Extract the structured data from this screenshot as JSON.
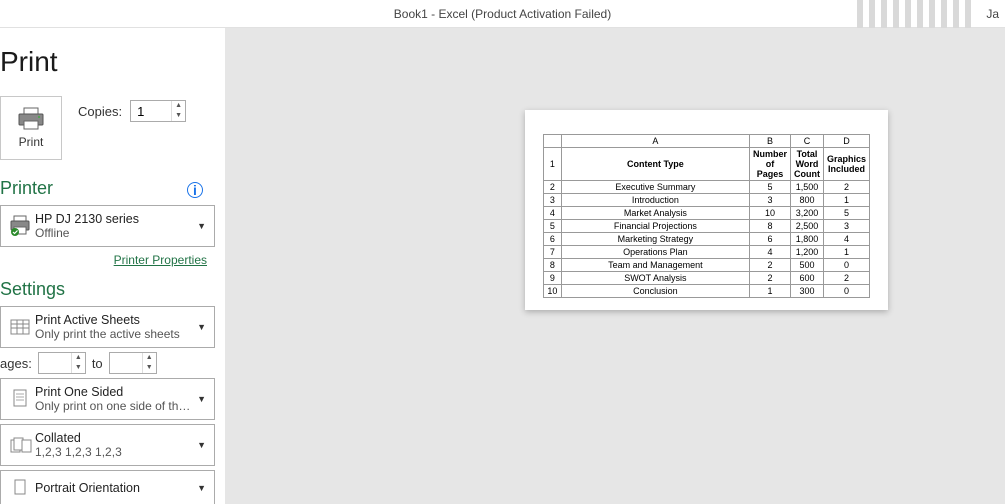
{
  "titlebar": {
    "title": "Book1  -  Excel (Product Activation Failed)",
    "user": "Ja"
  },
  "page_title": "Print",
  "print": {
    "button_label": "Print",
    "copies_label": "Copies:",
    "copies_value": "1"
  },
  "printer": {
    "heading": "Printer",
    "name": "HP DJ 2130 series",
    "status": "Offline",
    "properties_link": "Printer Properties"
  },
  "settings": {
    "heading": "Settings",
    "scope": {
      "line1": "Print Active Sheets",
      "line2": "Only print the active sheets"
    },
    "pages": {
      "label": "ages:",
      "to": "to",
      "from": "",
      "to_val": ""
    },
    "sides": {
      "line1": "Print One Sided",
      "line2": "Only print on one side of the..."
    },
    "collate": {
      "line1": "Collated",
      "line2": "1,2,3    1,2,3    1,2,3"
    },
    "orientation": {
      "line1": "Portrait Orientation",
      "line2": ""
    }
  },
  "chart_data": {
    "type": "table",
    "columns": [
      "A",
      "B",
      "C",
      "D"
    ],
    "headers": [
      "Content Type",
      "Number of Pages",
      "Total Word Count",
      "Graphics Included"
    ],
    "rows": [
      {
        "n": 1,
        "a": "Content Type",
        "b": "Number of Pages",
        "c": "Total Word Count",
        "d": "Graphics Included",
        "hdr": true
      },
      {
        "n": 2,
        "a": "Executive Summary",
        "b": "5",
        "c": "1,500",
        "d": "2"
      },
      {
        "n": 3,
        "a": "Introduction",
        "b": "3",
        "c": "800",
        "d": "1"
      },
      {
        "n": 4,
        "a": "Market Analysis",
        "b": "10",
        "c": "3,200",
        "d": "5"
      },
      {
        "n": 5,
        "a": "Financial Projections",
        "b": "8",
        "c": "2,500",
        "d": "3"
      },
      {
        "n": 6,
        "a": "Marketing Strategy",
        "b": "6",
        "c": "1,800",
        "d": "4"
      },
      {
        "n": 7,
        "a": "Operations Plan",
        "b": "4",
        "c": "1,200",
        "d": "1"
      },
      {
        "n": 8,
        "a": "Team and Management",
        "b": "2",
        "c": "500",
        "d": "0"
      },
      {
        "n": 9,
        "a": "SWOT Analysis",
        "b": "2",
        "c": "600",
        "d": "2"
      },
      {
        "n": 10,
        "a": "Conclusion",
        "b": "1",
        "c": "300",
        "d": "0"
      }
    ]
  }
}
